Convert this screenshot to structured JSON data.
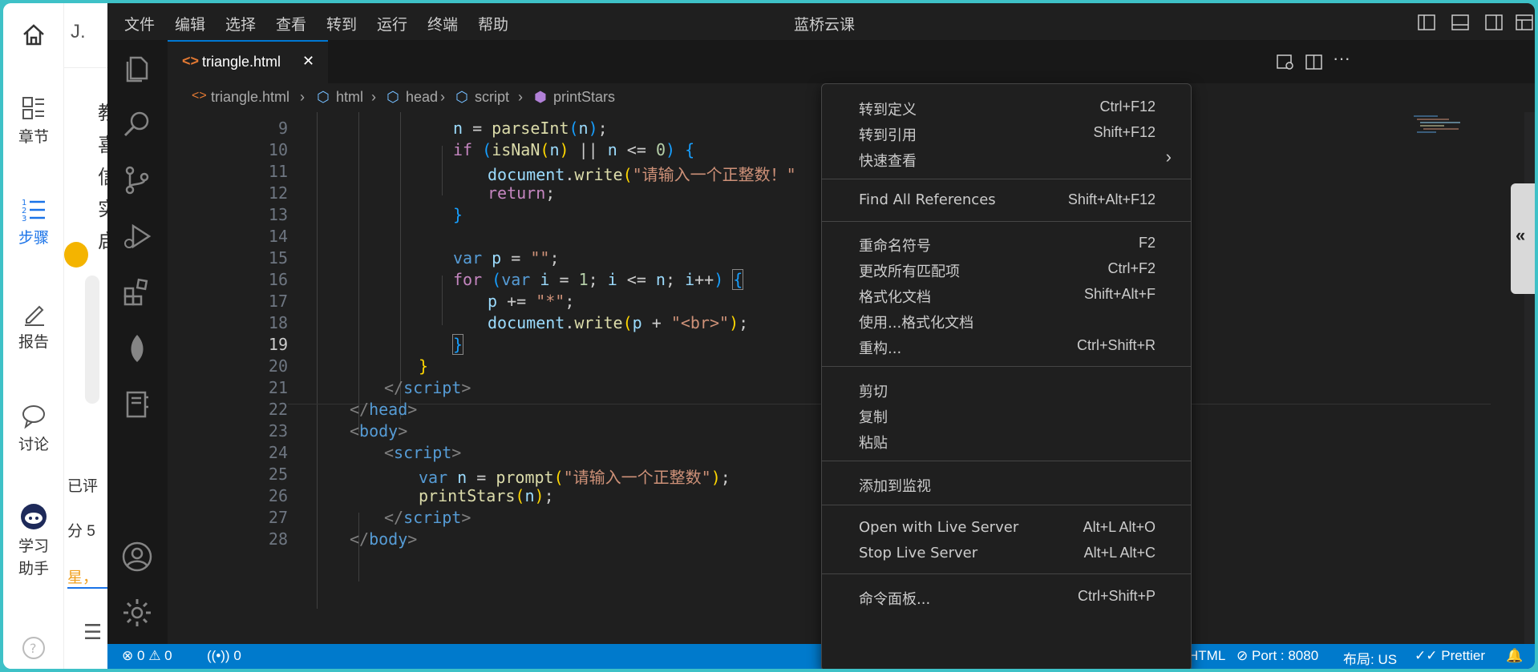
{
  "lanqiao": {
    "home_label": "J.",
    "nav": [
      {
        "label": "章节",
        "icon": "chapters-icon"
      },
      {
        "label": "步骤",
        "icon": "steps-icon"
      },
      {
        "label": "报告",
        "icon": "report-icon"
      },
      {
        "label": "讨论",
        "icon": "discuss-icon"
      },
      {
        "label": "学习助手",
        "icon": "assistant-icon"
      }
    ],
    "peek": [
      "教",
      "喜",
      "信",
      "实",
      "启",
      "已评",
      "分 5",
      "星，"
    ]
  },
  "vscode": {
    "menu": [
      "文件",
      "编辑",
      "选择",
      "查看",
      "转到",
      "运行",
      "终端",
      "帮助"
    ],
    "title": "蓝桥云课",
    "tab": {
      "label": "triangle.html",
      "close": "✕"
    },
    "breadcrumb": [
      "triangle.html",
      "html",
      "head",
      "script",
      "printStars"
    ],
    "status": {
      "errors": "0",
      "warnings": "0",
      "ports": "0",
      "lang": "HTML",
      "port": "Port : 8080",
      "layout": "布局: US",
      "prettier": "Prettier"
    }
  },
  "code_lines": [
    {
      "n": "9"
    },
    {
      "n": "10"
    },
    {
      "n": "11"
    },
    {
      "n": "12"
    },
    {
      "n": "13"
    },
    {
      "n": "14"
    },
    {
      "n": "15"
    },
    {
      "n": "16"
    },
    {
      "n": "17"
    },
    {
      "n": "18"
    },
    {
      "n": "19"
    },
    {
      "n": "20"
    },
    {
      "n": "21"
    },
    {
      "n": "22"
    },
    {
      "n": "23"
    },
    {
      "n": "24"
    },
    {
      "n": "25"
    },
    {
      "n": "26"
    },
    {
      "n": "27"
    },
    {
      "n": "28"
    }
  ],
  "context_menu": {
    "items": [
      {
        "label": "转到定义",
        "key": "Ctrl+F12"
      },
      {
        "label": "转到引用",
        "key": "Shift+F12"
      },
      {
        "label": "快速查看",
        "key": "›"
      },
      {
        "label": "Find All References",
        "key": "Shift+Alt+F12"
      },
      {
        "label": "重命名符号",
        "key": "F2"
      },
      {
        "label": "更改所有匹配项",
        "key": "Ctrl+F2"
      },
      {
        "label": "格式化文档",
        "key": "Shift+Alt+F"
      },
      {
        "label": "使用...格式化文档",
        "key": ""
      },
      {
        "label": "重构...",
        "key": "Ctrl+Shift+R"
      },
      {
        "label": "剪切",
        "key": ""
      },
      {
        "label": "复制",
        "key": ""
      },
      {
        "label": "粘贴",
        "key": ""
      },
      {
        "label": "添加到监视",
        "key": ""
      },
      {
        "label": "Open with Live Server",
        "key": "Alt+L Alt+O"
      },
      {
        "label": "Stop Live Server",
        "key": "Alt+L Alt+C"
      },
      {
        "label": "命令面板...",
        "key": "Ctrl+Shift+P"
      }
    ]
  }
}
